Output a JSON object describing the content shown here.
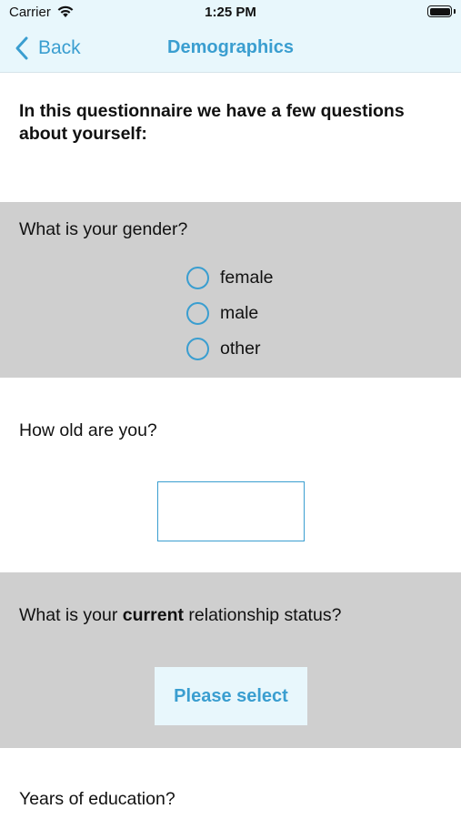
{
  "status_bar": {
    "carrier": "Carrier",
    "time": "1:25 PM"
  },
  "nav": {
    "back_label": "Back",
    "title": "Demographics"
  },
  "intro": "In this questionnaire we have a few questions about yourself:",
  "q_gender": {
    "question": "What is your gender?",
    "options": [
      "female",
      "male",
      "other"
    ]
  },
  "q_age": {
    "question": "How old are you?",
    "value": ""
  },
  "q_relationship": {
    "prefix": "What is your ",
    "emphasis": "current",
    "suffix": " relationship status?",
    "select_label": "Please select"
  },
  "q_education": {
    "question": "Years of education?"
  },
  "colors": {
    "accent": "#3a9ed0",
    "nav_background": "#e8f7fc",
    "section_gray": "#cfcfcf"
  }
}
